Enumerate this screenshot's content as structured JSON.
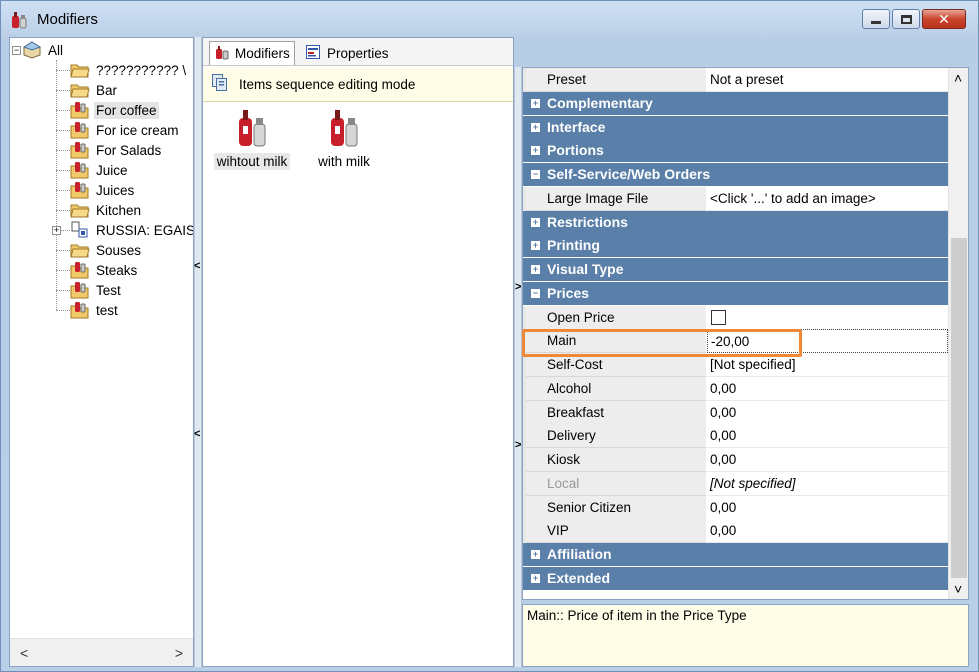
{
  "window": {
    "title": "Modifiers",
    "close_glyph": "✕"
  },
  "tree": {
    "root_label": "All",
    "items": [
      {
        "label": "??????????? \\",
        "icon": "folder-icon"
      },
      {
        "label": "Bar",
        "icon": "folder-icon"
      },
      {
        "label": "For coffee",
        "icon": "modifier-folder-icon",
        "selected": true
      },
      {
        "label": "For ice cream",
        "icon": "modifier-folder-icon"
      },
      {
        "label": "For Salads",
        "icon": "modifier-folder-icon"
      },
      {
        "label": "Juice",
        "icon": "modifier-folder-icon"
      },
      {
        "label": "Juices",
        "icon": "modifier-folder-icon"
      },
      {
        "label": "Kitchen",
        "icon": "folder-icon"
      },
      {
        "label": "RUSSIA: EGAIS",
        "icon": "egais-icon"
      },
      {
        "label": "Souses",
        "icon": "folder-icon"
      },
      {
        "label": "Steaks",
        "icon": "modifier-folder-icon"
      },
      {
        "label": "Test",
        "icon": "modifier-folder-icon"
      },
      {
        "label": "test",
        "icon": "modifier-folder-icon"
      }
    ],
    "scroll_left": "<",
    "scroll_right": ">"
  },
  "splitters": {
    "left_arrow": "<",
    "right_arrow": ">"
  },
  "center": {
    "tabs": [
      {
        "label": "Modifiers",
        "active": true
      },
      {
        "label": "Properties",
        "active": false
      }
    ],
    "seq_mode_label": "Items sequence editing mode",
    "items": [
      {
        "label": "wihtout milk",
        "selected": true
      },
      {
        "label": "with milk",
        "selected": false
      }
    ]
  },
  "properties": {
    "rows": [
      {
        "kind": "prop",
        "name": "Preset",
        "value": "Not a preset"
      },
      {
        "kind": "cat",
        "name": "Complementary",
        "expanded": false
      },
      {
        "kind": "cat",
        "name": "Interface",
        "expanded": false
      },
      {
        "kind": "cat",
        "name": "Portions",
        "expanded": false
      },
      {
        "kind": "cat",
        "name": "Self-Service/Web Orders",
        "expanded": true
      },
      {
        "kind": "prop",
        "name": "Large Image File",
        "value": "<Click '...' to add an image>"
      },
      {
        "kind": "cat",
        "name": "Restrictions",
        "expanded": false
      },
      {
        "kind": "cat",
        "name": "Printing",
        "expanded": false
      },
      {
        "kind": "cat",
        "name": "Visual Type",
        "expanded": false
      },
      {
        "kind": "cat",
        "name": "Prices",
        "expanded": true
      },
      {
        "kind": "prop",
        "name": "Open Price",
        "value": "",
        "checkbox": true,
        "checked": false
      },
      {
        "kind": "prop",
        "name": "Main",
        "value": "-20,00",
        "focused": true
      },
      {
        "kind": "prop",
        "name": "Self-Cost",
        "value": "[Not specified]"
      },
      {
        "kind": "prop",
        "name": "Alcohol",
        "value": "0,00"
      },
      {
        "kind": "prop",
        "name": "Breakfast",
        "value": "0,00"
      },
      {
        "kind": "prop",
        "name": "Delivery",
        "value": "0,00"
      },
      {
        "kind": "prop",
        "name": "Kiosk",
        "value": "0,00"
      },
      {
        "kind": "prop",
        "name": "Local",
        "value": "[Not specified]",
        "disabled": true
      },
      {
        "kind": "prop",
        "name": "Senior Citizen",
        "value": "0,00"
      },
      {
        "kind": "prop",
        "name": "VIP",
        "value": "0,00"
      },
      {
        "kind": "cat",
        "name": "Affiliation",
        "expanded": false
      },
      {
        "kind": "cat",
        "name": "Extended",
        "expanded": false
      }
    ],
    "scroll_up": "˄",
    "scroll_down": "˅",
    "description": "Main:: Price of item in the Price Type"
  },
  "colors": {
    "category_bg": "#5a7fa8",
    "highlight": "#f0883a",
    "info_bg": "#fffde7"
  }
}
